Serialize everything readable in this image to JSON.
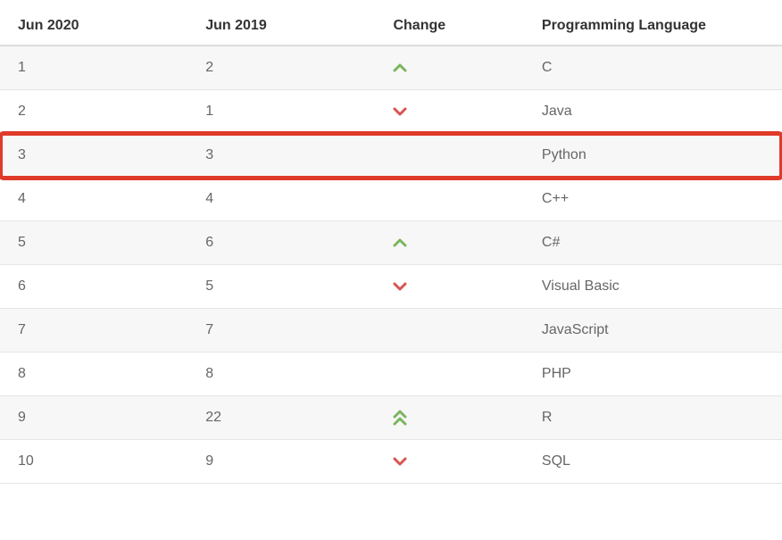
{
  "table": {
    "headers": {
      "jun2020": "Jun 2020",
      "jun2019": "Jun 2019",
      "change": "Change",
      "language": "Programming Language"
    },
    "rows": [
      {
        "jun2020": "1",
        "jun2019": "2",
        "change": "up",
        "language": "C",
        "highlighted": false
      },
      {
        "jun2020": "2",
        "jun2019": "1",
        "change": "down",
        "language": "Java",
        "highlighted": false
      },
      {
        "jun2020": "3",
        "jun2019": "3",
        "change": "none",
        "language": "Python",
        "highlighted": true
      },
      {
        "jun2020": "4",
        "jun2019": "4",
        "change": "none",
        "language": "C++",
        "highlighted": false
      },
      {
        "jun2020": "5",
        "jun2019": "6",
        "change": "up",
        "language": "C#",
        "highlighted": false
      },
      {
        "jun2020": "6",
        "jun2019": "5",
        "change": "down",
        "language": "Visual Basic",
        "highlighted": false
      },
      {
        "jun2020": "7",
        "jun2019": "7",
        "change": "none",
        "language": "JavaScript",
        "highlighted": false
      },
      {
        "jun2020": "8",
        "jun2019": "8",
        "change": "none",
        "language": "PHP",
        "highlighted": false
      },
      {
        "jun2020": "9",
        "jun2019": "22",
        "change": "double-up",
        "language": "R",
        "highlighted": false
      },
      {
        "jun2020": "10",
        "jun2019": "9",
        "change": "down",
        "language": "SQL",
        "highlighted": false
      }
    ]
  }
}
